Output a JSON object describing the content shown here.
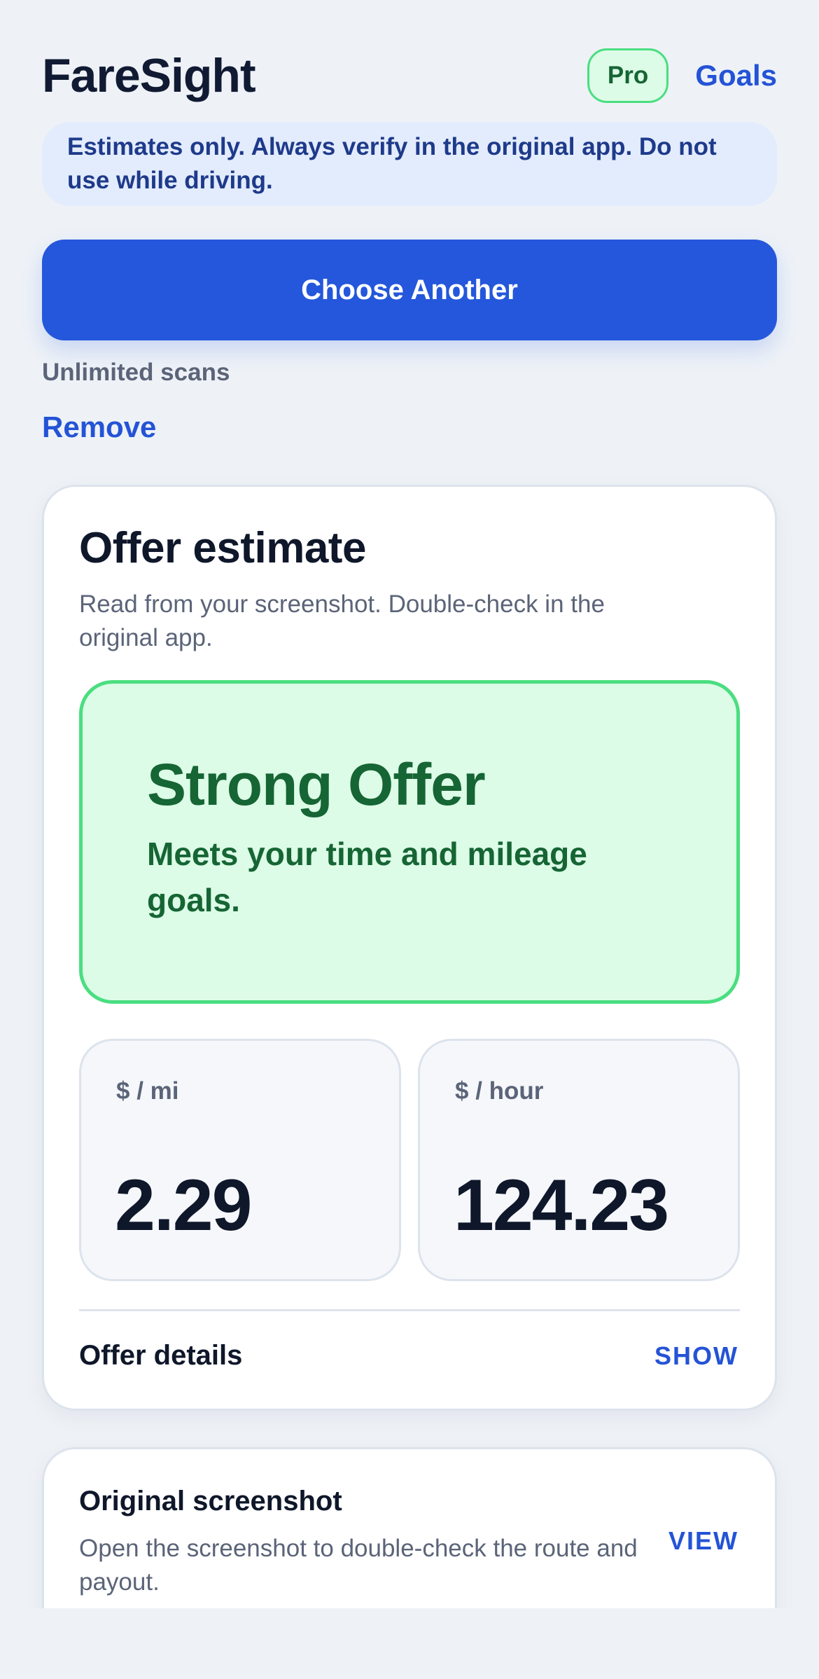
{
  "header": {
    "app_title": "FareSight",
    "badge": "Pro",
    "goals_link": "Goals"
  },
  "notice": {
    "text": "Estimates only. Always verify in the original app. Do not use while driving."
  },
  "actions": {
    "choose_button": "Choose Another",
    "scans_status": "Unlimited scans",
    "remove_link": "Remove"
  },
  "estimate_card": {
    "title": "Offer estimate",
    "subtitle": "Read from your screenshot. Double-check in the original app.",
    "verdict": {
      "title": "Strong Offer",
      "text": "Meets your time and mileage goals."
    },
    "metrics": [
      {
        "label": "$ / mi",
        "value": "2.29"
      },
      {
        "label": "$ / hour",
        "value": "124.23"
      }
    ],
    "details": {
      "label": "Offer details",
      "action": "SHOW"
    }
  },
  "screenshot_card": {
    "title": "Original screenshot",
    "text": "Open the screenshot to double-check the route and payout.",
    "action": "VIEW"
  },
  "colors": {
    "accent": "#2457db",
    "success_bg": "#dcfce7",
    "success_border": "#4ade80",
    "success_text": "#166534",
    "page_bg": "#eef2f7"
  }
}
